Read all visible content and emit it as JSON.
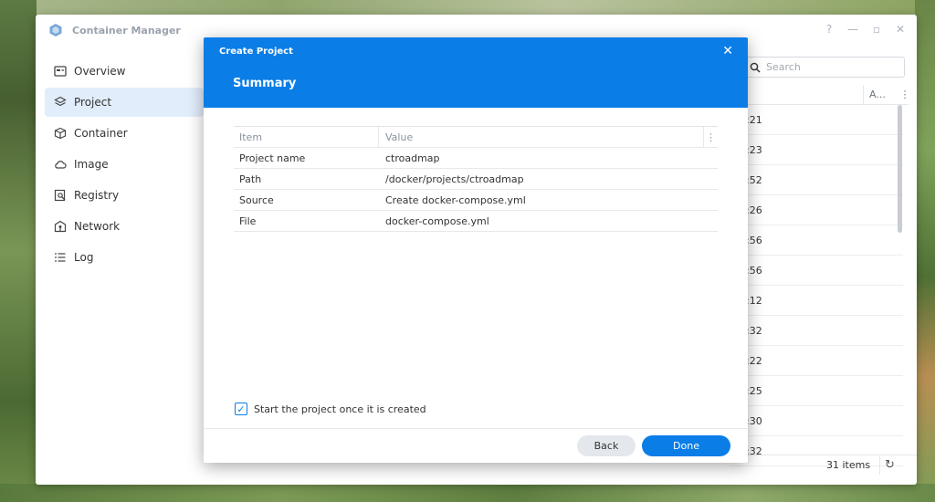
{
  "app": {
    "title": "Container Manager",
    "controls": [
      "?",
      "—",
      "▫",
      "✕"
    ]
  },
  "sidebar": {
    "items": [
      {
        "label": "Overview",
        "icon": "overview-icon"
      },
      {
        "label": "Project",
        "icon": "project-icon",
        "active": true
      },
      {
        "label": "Container",
        "icon": "container-icon"
      },
      {
        "label": "Image",
        "icon": "image-cloud-icon"
      },
      {
        "label": "Registry",
        "icon": "registry-icon"
      },
      {
        "label": "Network",
        "icon": "network-icon"
      },
      {
        "label": "Log",
        "icon": "log-icon"
      }
    ]
  },
  "list": {
    "search_placeholder": "Search",
    "column_a": "A...",
    "column_more": "⋮",
    "rows": [
      ":21",
      ":23",
      ":52",
      ":26",
      ":56",
      ":56",
      ":12",
      ":32",
      ":22",
      ":25",
      ":30",
      ":32"
    ],
    "item_count": "31 items",
    "refresh_glyph": "↻"
  },
  "modal": {
    "title_small": "Create Project",
    "close_glyph": "✕",
    "title_large": "Summary",
    "table": {
      "headers": {
        "item": "Item",
        "value": "Value",
        "more": "⋮"
      },
      "rows": [
        {
          "item": "Project name",
          "value": "ctroadmap"
        },
        {
          "item": "Path",
          "value": "/docker/projects/ctroadmap"
        },
        {
          "item": "Source",
          "value": "Create docker-compose.yml"
        },
        {
          "item": "File",
          "value": "docker-compose.yml"
        }
      ]
    },
    "checkbox": {
      "label": "Start the project once it is created",
      "checked": true,
      "check_glyph": "✓"
    },
    "buttons": {
      "back": "Back",
      "done": "Done"
    }
  },
  "colors": {
    "accent": "#0a7de7",
    "active_nav": "#e1edfa"
  }
}
